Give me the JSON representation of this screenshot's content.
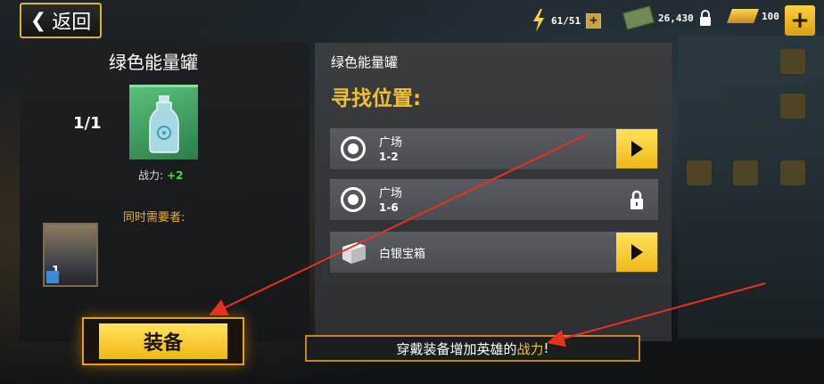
{
  "header": {
    "back_label": "返回",
    "energy": "61/51",
    "cash": "26,430",
    "gold": "100"
  },
  "item": {
    "title": "绿色能量罐",
    "count": "1/1",
    "power_label": "战力:",
    "power_value": "+2",
    "also_needed_label": "同时需要者:",
    "hero_level": "1",
    "equip_label": "装备"
  },
  "source": {
    "item_name": "绿色能量罐",
    "heading": "寻找位置:",
    "locations": [
      {
        "name": "广场",
        "stage": "1-2",
        "state": "go"
      },
      {
        "name": "广场",
        "stage": "1-6",
        "state": "locked"
      },
      {
        "name": "白银宝箱",
        "stage": "",
        "state": "go"
      }
    ]
  },
  "tip": {
    "prefix": "穿戴装备增加英雄的",
    "highlight": "战力",
    "suffix": "!"
  },
  "colors": {
    "accent_gold": "#f0c030",
    "power_green": "#44dd44",
    "annotation_red": "#e83020"
  }
}
